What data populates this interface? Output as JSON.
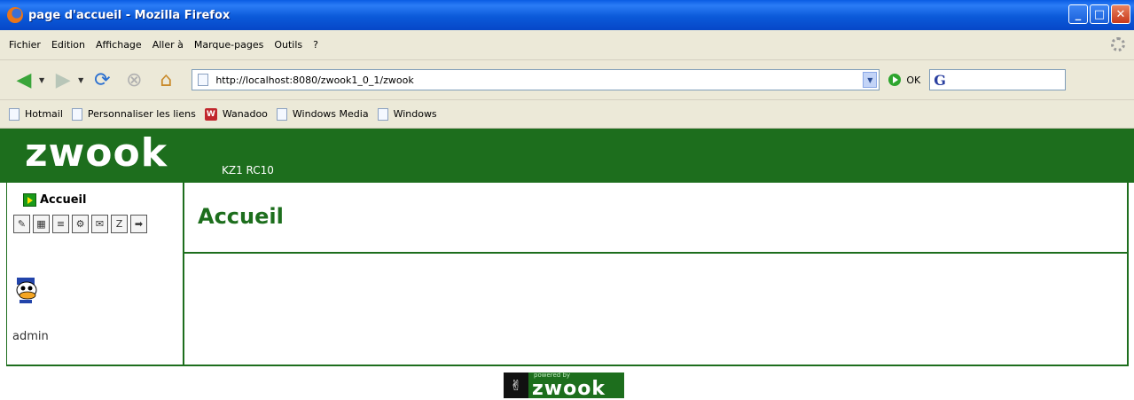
{
  "window": {
    "title": "page d'accueil - Mozilla Firefox",
    "controls": [
      "_",
      "□",
      "✕"
    ]
  },
  "menubar": {
    "items": [
      "Fichier",
      "Edition",
      "Affichage",
      "Aller à",
      "Marque-pages",
      "Outils",
      "?"
    ]
  },
  "navbar": {
    "url": "http://localhost:8080/zwook1_0_1/zwook",
    "ok_label": "OK",
    "search_logo": "G",
    "icons": [
      "back-icon",
      "forward-icon",
      "reload-icon",
      "stop-icon",
      "home-icon"
    ]
  },
  "bookmarks": {
    "items": [
      "Hotmail",
      "Personnaliser les liens",
      "Wanadoo",
      "Windows Media",
      "Windows"
    ],
    "wanadoo_badge": "W"
  },
  "app": {
    "logo_text": "zwook",
    "version": "KZ1 RC10",
    "brand_color": "#1d6e1d",
    "sidebar": {
      "home_label": "Accueil",
      "user_name": "admin",
      "tool_icons": [
        "✎",
        "▦",
        "≡",
        "⚙",
        "✉",
        "Z",
        "➡"
      ]
    },
    "main": {
      "heading": "Accueil"
    },
    "footer": {
      "powered_small": "powered by",
      "powered_logo": "zwook"
    }
  }
}
